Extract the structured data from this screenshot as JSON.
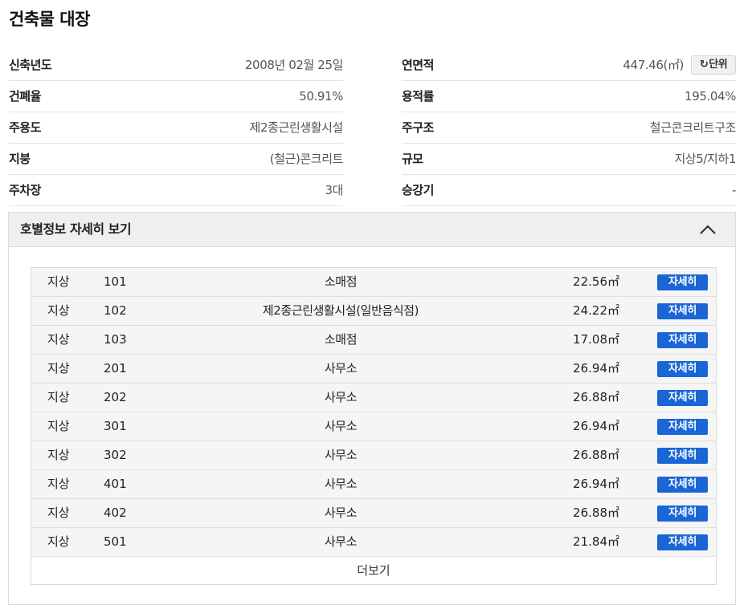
{
  "title": "건축물 대장",
  "info_left": [
    {
      "label": "신축년도",
      "value": "2008년 02월 25일"
    },
    {
      "label": "건폐율",
      "value": "50.91%"
    },
    {
      "label": "주용도",
      "value": "제2종근린생활시설"
    },
    {
      "label": "지붕",
      "value": "(철근)콘크리트"
    },
    {
      "label": "주차장",
      "value": "3대"
    }
  ],
  "info_right": [
    {
      "label": "연면적",
      "value": "447.46(㎡)"
    },
    {
      "label": "용적률",
      "value": "195.04%"
    },
    {
      "label": "주구조",
      "value": "철근콘크리트구조"
    },
    {
      "label": "규모",
      "value": "지상5/지하1"
    },
    {
      "label": "승강기",
      "value": "-"
    }
  ],
  "unit_button": {
    "icon": "refresh-icon",
    "glyph": "↻",
    "label": "단위"
  },
  "panel": {
    "title": "호별정보 자세히 보기",
    "expanded": true
  },
  "units": [
    {
      "floor_type": "지상",
      "ho": "101",
      "use": "소매점",
      "area": "22.56㎡",
      "action": "자세히"
    },
    {
      "floor_type": "지상",
      "ho": "102",
      "use": "제2종근린생활시설(일반음식점)",
      "area": "24.22㎡",
      "action": "자세히"
    },
    {
      "floor_type": "지상",
      "ho": "103",
      "use": "소매점",
      "area": "17.08㎡",
      "action": "자세히"
    },
    {
      "floor_type": "지상",
      "ho": "201",
      "use": "사무소",
      "area": "26.94㎡",
      "action": "자세히"
    },
    {
      "floor_type": "지상",
      "ho": "202",
      "use": "사무소",
      "area": "26.88㎡",
      "action": "자세히"
    },
    {
      "floor_type": "지상",
      "ho": "301",
      "use": "사무소",
      "area": "26.94㎡",
      "action": "자세히"
    },
    {
      "floor_type": "지상",
      "ho": "302",
      "use": "사무소",
      "area": "26.88㎡",
      "action": "자세히"
    },
    {
      "floor_type": "지상",
      "ho": "401",
      "use": "사무소",
      "area": "26.94㎡",
      "action": "자세히"
    },
    {
      "floor_type": "지상",
      "ho": "402",
      "use": "사무소",
      "area": "26.88㎡",
      "action": "자세히"
    },
    {
      "floor_type": "지상",
      "ho": "501",
      "use": "사무소",
      "area": "21.84㎡",
      "action": "자세히"
    }
  ],
  "more_label": "더보기",
  "colors": {
    "accent": "#1a66d6",
    "header_bg": "#efefef",
    "row_bg": "#f5f5f5"
  }
}
